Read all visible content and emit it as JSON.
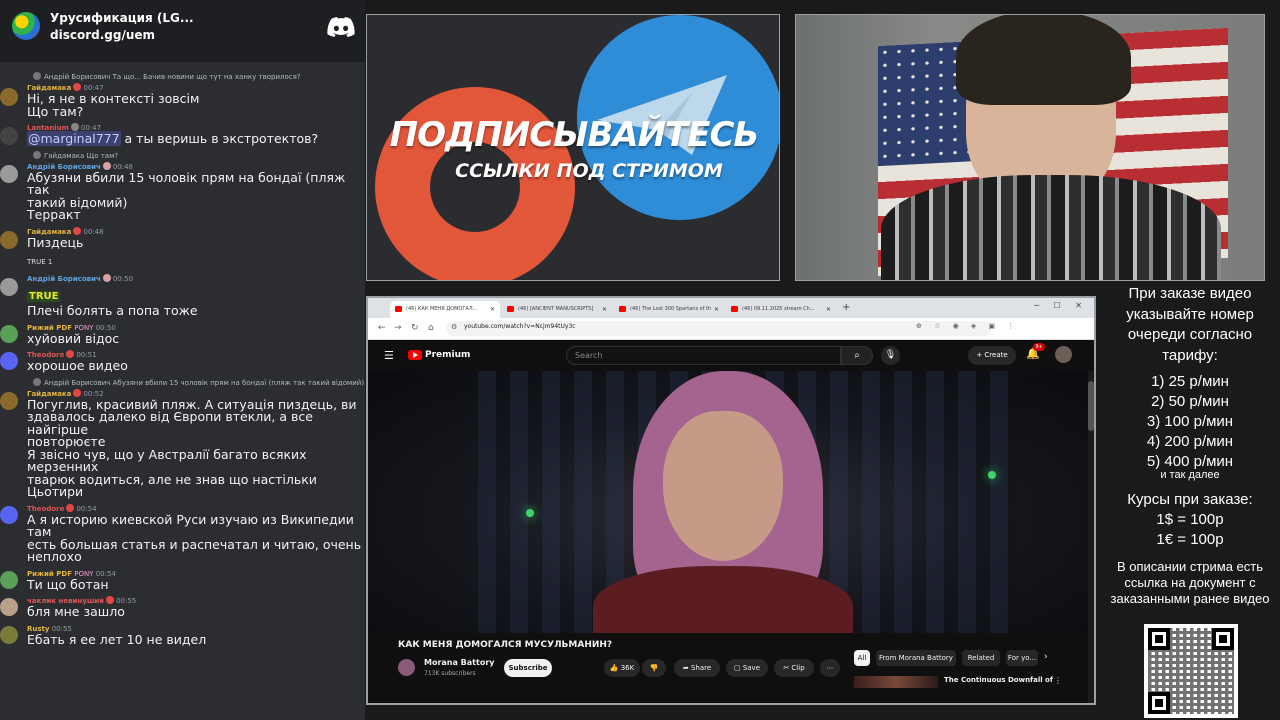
{
  "chat": {
    "server_name": "Урусификация (LG...",
    "server_invite": "discord.gg/uem",
    "messages": [
      {
        "reply": "Андрій Борисович Та що... Бачив новини що тут на ханку творилося?",
        "name": "Гайдамака",
        "name_color": "#e2b43c",
        "time": "00:47",
        "lines": [
          "Ні, я не в контексті зовсім",
          "Що там?"
        ]
      },
      {
        "reply": "",
        "name": "Lantanium",
        "name_color": "#e05555",
        "time": "00:47",
        "mention": "@marginal777",
        "text": " а ты веришь в экстротектов?"
      },
      {
        "reply": "Гайдамака Що там?",
        "name": "Андрій Борисович",
        "name_color": "#5fa3e0",
        "time": "00:48",
        "lines": [
          "Абузяни вбили 15 чоловік прям на бондаї (пляж так",
          "такий відомий)",
          "Терракт"
        ]
      },
      {
        "reply": "",
        "name": "Гайдамака",
        "name_color": "#e2b43c",
        "time": "00:48",
        "lines": [
          "Пиздець"
        ],
        "reaction": "TRUE 1"
      },
      {
        "reply": "",
        "name": "Андрій Борисович",
        "name_color": "#5fa3e0",
        "time": "00:50",
        "emoji": "TRUE",
        "lines": [
          "Плечі болять а попа тоже"
        ]
      },
      {
        "reply": "",
        "name": "Рижий PDF",
        "name_color": "#e2b43c",
        "tag": "PONY",
        "time": "00:50",
        "lines": [
          "хуйовий відос"
        ]
      },
      {
        "reply": "",
        "name": "Theodore",
        "name_color": "#e05555",
        "time": "00:51",
        "lines": [
          "хорошое видео"
        ]
      },
      {
        "reply": "Андрій Борисович Абузяни вбили 15 чоловік прям на бондаї (пляж так такий відомий)",
        "name": "Гайдамака",
        "name_color": "#e2b43c",
        "time": "00:52",
        "lines": [
          "Погуглив, красивий пляж. А ситуація пиздець, ви",
          "здавалось далеко від Європи втекли, а все найгірше",
          "повторюєте",
          "Я звісно чув, що у Австралії багато всяких мерзенних",
          "тварюк водиться, але не знав що настільки",
          "Цьотири"
        ]
      },
      {
        "reply": "",
        "name": "Theodore",
        "name_color": "#e05555",
        "time": "00:54",
        "lines": [
          "А я историю киевской Руси изучаю из Википедии там",
          "есть большая статья и распечатал и читаю, очень",
          "неплохо"
        ]
      },
      {
        "reply": "",
        "name": "Рижий PDF",
        "name_color": "#e2b43c",
        "tag": "PONY",
        "time": "00:54",
        "lines": [
          "Ти що ботан"
        ]
      },
      {
        "reply": "",
        "name": "чаклик невинуший",
        "name_color": "#e05555",
        "time": "00:55",
        "lines": [
          "бля мне зашло"
        ]
      },
      {
        "reply": "",
        "name": "Rusty",
        "name_color": "#e2b43c",
        "time": "00:55",
        "lines": [
          "Ебать я ее лет 10 не видел"
        ]
      }
    ]
  },
  "promo": {
    "title": "ПОДПИСЫВАЙТЕСЬ",
    "subtitle": "ССЫЛКИ ПОД СТРИМОМ"
  },
  "browser": {
    "tabs": [
      "(46) КАК МЕНЯ ДОМОГАЛ...",
      "(46) [ANCIENT MANUSCRIPTS]",
      "(46) The Lost 300 Spartans of th",
      "(46) 09.11.2025 stream Ch..."
    ],
    "url": "youtube.com/watch?v=Ncjm94tUy3c",
    "search_placeholder": "Search",
    "premium_label": "Premium",
    "create_label": "+ Create",
    "bell_badge": "9+",
    "video_title": "КАК МЕНЯ ДОМОГАЛСЯ МУСУЛЬМАНИН?",
    "channel_name": "Morana Battory",
    "channel_subs": "713K subscribers",
    "subscribe_label": "Subscribe",
    "likes": "36K",
    "share_label": "Share",
    "save_label": "Save",
    "clip_label": "Clip",
    "chips": [
      "All",
      "From Morana Battory",
      "Related",
      "For yo..."
    ],
    "rec_title": "The Continuous Downfall of"
  },
  "info": {
    "intro": "При заказе видео указывайте номер очереди согласно тарифу:",
    "rates": [
      "1) 25 р/мин",
      "2) 50 р/мин",
      "3) 100 р/мин",
      "4) 200 р/мин",
      "5) 400 р/мин"
    ],
    "etc": "и так далее",
    "course_title": "Курсы при заказе:",
    "course_1": "1$ = 100р",
    "course_2": "1€ = 100р",
    "desc": "В описании стрима есть ссылка на документ с заказанными ранее видео"
  }
}
